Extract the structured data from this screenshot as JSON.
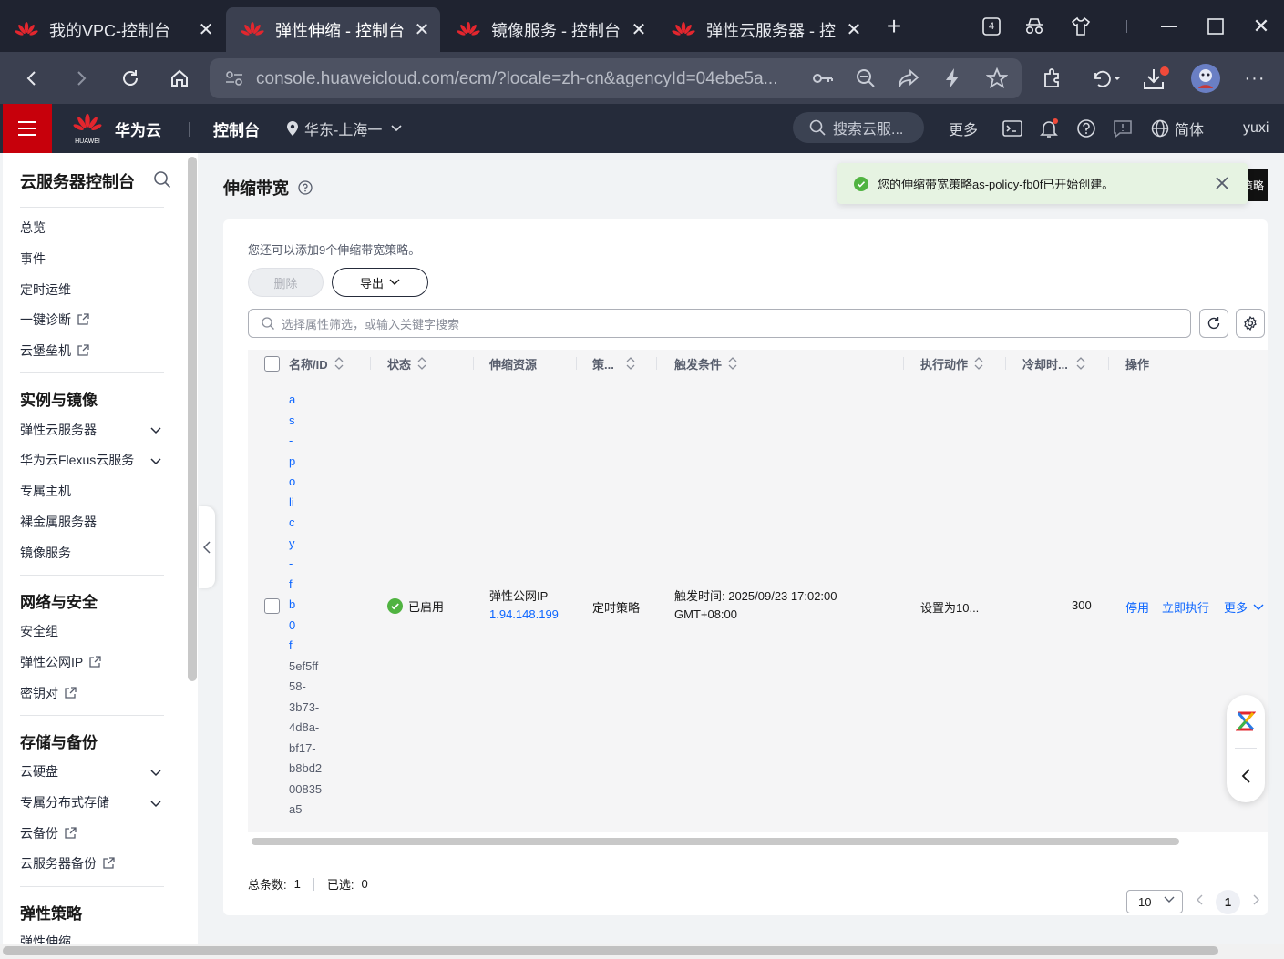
{
  "browser": {
    "tabs": [
      {
        "title": "我的VPC-控制台",
        "active": false
      },
      {
        "title": "弹性伸缩 - 控制台",
        "active": true
      },
      {
        "title": "镜像服务 - 控制台",
        "active": false
      },
      {
        "title": "弹性云服务器 - 控",
        "active": false
      }
    ],
    "tab_count": "4",
    "url": "console.huaweicloud.com/ecm/?locale=zh-cn&agencyId=04ebe5a..."
  },
  "header": {
    "brand": "华为云",
    "logo_text": "HUAWEI",
    "console": "控制台",
    "region": "华东-上海一",
    "search_placeholder": "搜索云服...",
    "more": "更多",
    "language": "简体",
    "user": "yuxi"
  },
  "sidebar": {
    "title": "云服务器控制台",
    "top_items": [
      "总览",
      "事件",
      "定时运维",
      "一键诊断",
      "云堡垒机"
    ],
    "sections": [
      {
        "title": "实例与镜像",
        "items": [
          "弹性云服务器",
          "华为云Flexus云服务",
          "专属主机",
          "裸金属服务器",
          "镜像服务"
        ]
      },
      {
        "title": "网络与安全",
        "items": [
          "安全组",
          "弹性公网IP",
          "密钥对"
        ]
      },
      {
        "title": "存储与备份",
        "items": [
          "云硬盘",
          "专属分布式存储",
          "云备份",
          "云服务器备份"
        ]
      },
      {
        "title": "弹性策略",
        "items": [
          "弹性伸缩"
        ]
      }
    ]
  },
  "main": {
    "title": "伸缩带宽",
    "toast": "您的伸缩带宽策略as-policy-fb0f已开始创建。",
    "toast_edge": "策略",
    "quota_tip": "您还可以添加9个伸缩带宽策略。",
    "delete_label": "删除",
    "export_label": "导出",
    "filter_placeholder": "选择属性筛选，或输入关键字搜索",
    "columns": [
      "名称/ID",
      "状态",
      "伸缩资源",
      "策...",
      "触发条件",
      "执行动作",
      "冷却时...",
      "操作"
    ],
    "row": {
      "name_chars": [
        "a",
        "s",
        "-",
        "p",
        "o",
        "li",
        "c",
        "y",
        "-",
        "f",
        "b",
        "0",
        "f"
      ],
      "id_lines": [
        "5ef5ff",
        "58-",
        "3b73-",
        "4d8a-",
        "bf17-",
        "b8bd2",
        "00835",
        "a5"
      ],
      "status": "已启用",
      "resource_type": "弹性公网IP",
      "resource_ip": "1.94.148.199",
      "policy_type": "定时策略",
      "trigger_line1": "触发时间: 2025/09/23 17:02:00",
      "trigger_line2": "GMT+08:00",
      "action": "设置为10...",
      "cooldown": "300",
      "op_disable": "停用",
      "op_execute": "立即执行",
      "op_more": "更多"
    },
    "footer": {
      "total_label": "总条数:",
      "total": "1",
      "selected_label": "已选:",
      "selected": "0",
      "page_size": "10",
      "current_page": "1"
    }
  },
  "colors": {
    "accent_blue": "#0d66ff",
    "brand_red": "#c7000b",
    "header_bg": "#252b3a",
    "success": "#50b341"
  }
}
